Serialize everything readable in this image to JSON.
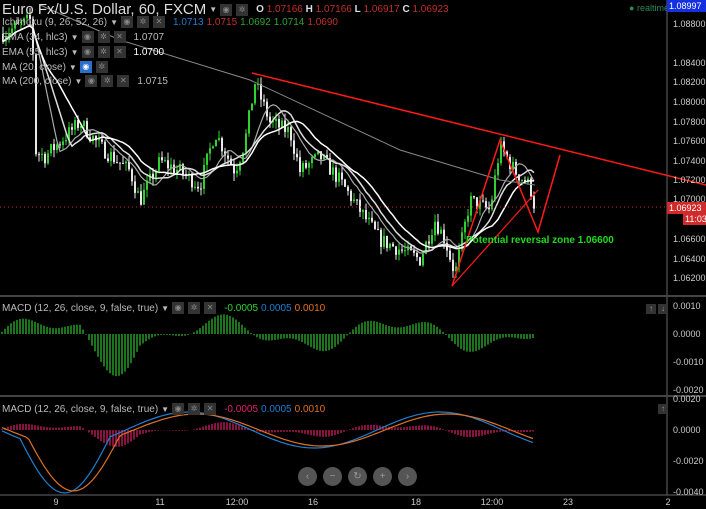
{
  "header": {
    "symbol_title": "Euro Fx/U.S. Dollar, 60, FXCM",
    "ohlc": {
      "o_label": "O",
      "o": "1.07166",
      "h_label": "H",
      "h": "1.07166",
      "l_label": "L",
      "l": "1.06917",
      "c_label": "C",
      "c": "1.06923"
    },
    "realtime": "realtime"
  },
  "indicators": [
    {
      "label": "Ichimoku (9, 26, 52, 26)",
      "values": [
        "1.0713",
        "1.0715",
        "1.0692",
        "1.0714",
        "1.0690"
      ]
    },
    {
      "label": "EMA (34, hlc3)",
      "values": [
        "1.0707"
      ]
    },
    {
      "label": "EMA (55, hlc3)",
      "values": [
        "1.0700"
      ]
    },
    {
      "label": "MA (20, close)",
      "values": []
    },
    {
      "label": "MA (200, close)",
      "values": [
        "1.0715"
      ]
    }
  ],
  "annotation": "Potential reversal zone 1.06600",
  "price_axis": {
    "ticks": [
      "1.08800",
      "1.08400",
      "1.08200",
      "1.08000",
      "1.07800",
      "1.07600",
      "1.07400",
      "1.07200",
      "1.07000",
      "1.06600",
      "1.06400",
      "1.06200"
    ],
    "top_badge": "1.08997",
    "last_price": "1.06923",
    "countdown": "11:03"
  },
  "macd1": {
    "label": "MACD (12, 26, close, 9, false, true)",
    "values": [
      "-0.0005",
      "0.0005",
      "0.0010"
    ],
    "ticks": [
      "0.0010",
      "0.0000",
      "-0.0010",
      "-0.0020"
    ]
  },
  "macd2": {
    "label": "MACD (12, 26, close, 9, false, true)",
    "values": [
      "-0.0005",
      "0.0005",
      "0.0010"
    ],
    "ticks": [
      "0.0020",
      "0.0000",
      "-0.0020",
      "-0.0040"
    ]
  },
  "time_axis": [
    "9",
    "11",
    "12:00",
    "16",
    "18",
    "12:00",
    "23",
    "2"
  ],
  "nav": {
    "left": "‹",
    "zoom_out": "−",
    "reset": "↻",
    "zoom_in": "+",
    "right": "›"
  },
  "colors": {
    "up": "#2fd02f",
    "down": "#e8e8e8",
    "trend": "#ff1a1a",
    "macd_hist": "#2fc22f",
    "macd_line": "#1e7fd0",
    "signal_line": "#e07020",
    "hist_pink": "#e0206a"
  }
}
